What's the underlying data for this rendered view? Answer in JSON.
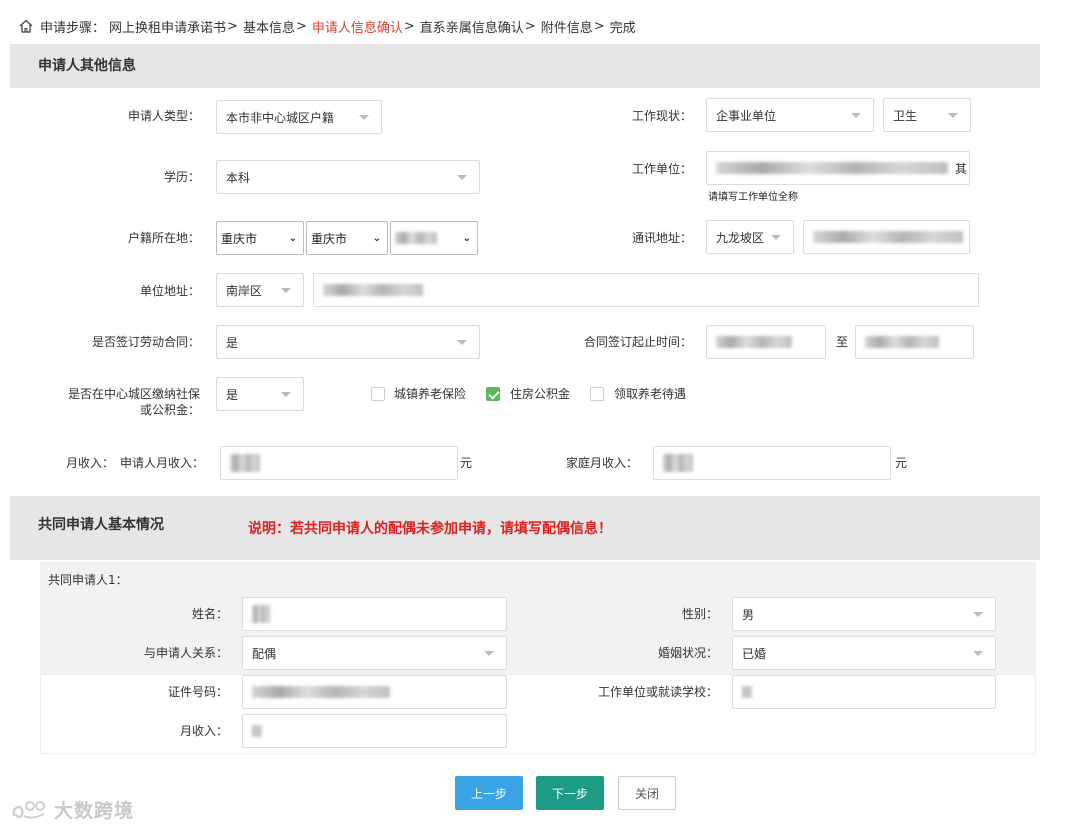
{
  "breadcrumb": {
    "prefix": "申请步骤：",
    "steps": [
      "网上换租申请承诺书",
      "基本信息",
      "申请人信息确认",
      "直系亲属信息确认",
      "附件信息",
      "完成"
    ],
    "sep": ">"
  },
  "section1": {
    "title": "申请人其他信息"
  },
  "form": {
    "applicant_type": {
      "label": "申请人类型：",
      "value": "本市非中心城区户籍"
    },
    "work_status": {
      "label": "工作现状：",
      "value": "企事业单位",
      "sub_value": "卫生"
    },
    "education": {
      "label": "学历：",
      "value": "本科"
    },
    "work_unit": {
      "label": "工作单位：",
      "hint": "请填写工作单位全称",
      "tail": "其"
    },
    "household": {
      "label": "户籍所在地：",
      "province": "重庆市",
      "city": "重庆市"
    },
    "contact_addr": {
      "label": "通讯地址：",
      "district": "九龙坡区"
    },
    "unit_addr": {
      "label": "单位地址：",
      "district": "南岸区"
    },
    "labor_contract": {
      "label": "是否签订劳动合同：",
      "value": "是"
    },
    "contract_period": {
      "label": "合同签订起止时间：",
      "to": "至"
    },
    "social_security": {
      "label_line1": "是否在中心城区缴纳社保",
      "label_line2": "或公积金：",
      "value": "是"
    },
    "checkboxes": [
      {
        "label": "城镇养老保险",
        "checked": false
      },
      {
        "label": "住房公积金",
        "checked": true
      },
      {
        "label": "领取养老待遇",
        "checked": false
      }
    ],
    "income": {
      "label": "月收入：",
      "applicant_label": "申请人月收入：",
      "unit": "元",
      "family_label": "家庭月收入："
    }
  },
  "section2": {
    "title": "共同申请人基本情况",
    "note": "说明：若共同申请人的配偶未参加申请，请填写配偶信息！"
  },
  "co_applicant": {
    "heading": "共同申请人1：",
    "name_label": "姓名：",
    "gender": {
      "label": "性别：",
      "value": "男"
    },
    "relation": {
      "label": "与申请人关系：",
      "value": "配偶"
    },
    "marital": {
      "label": "婚姻状况：",
      "value": "已婚"
    },
    "id_label": "证件号码：",
    "work_label": "工作单位或就读学校：",
    "income_label": "月收入："
  },
  "buttons": {
    "prev": "上一步",
    "next": "下一步",
    "close": "关闭"
  },
  "watermark": "大数跨境",
  "colors": {
    "accent_red": "#e23b2e",
    "btn_blue": "#3aa3e6",
    "btn_green": "#1e9b84",
    "check_green": "#5cb85c"
  }
}
